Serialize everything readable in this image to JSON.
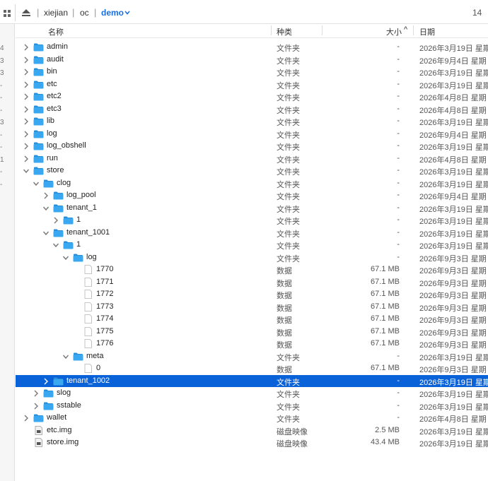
{
  "breadcrumbs": [
    "xiejian",
    "oc",
    "demo"
  ],
  "breadcrumb_separator": "|",
  "item_count": "14",
  "sidebar_fragments": [
    "4",
    "3",
    "3",
    "-",
    "-",
    "-",
    "3",
    "-",
    "-",
    "1",
    "-",
    "-"
  ],
  "columns": {
    "name": "名称",
    "kind": "种类",
    "size": "大小",
    "size_sort": "^",
    "date": "日期"
  },
  "rows": [
    {
      "name": "admin",
      "kind": "文件夹",
      "size": "-",
      "date": "2026年3月19日 星期",
      "level": 0,
      "type": "folder",
      "disc": "right"
    },
    {
      "name": "audit",
      "kind": "文件夹",
      "size": "-",
      "date": "2026年9月4日 星期",
      "level": 0,
      "type": "folder",
      "disc": "right"
    },
    {
      "name": "bin",
      "kind": "文件夹",
      "size": "-",
      "date": "2026年3月19日 星期",
      "level": 0,
      "type": "folder",
      "disc": "right"
    },
    {
      "name": "etc",
      "kind": "文件夹",
      "size": "-",
      "date": "2026年3月19日 星期",
      "level": 0,
      "type": "folder",
      "disc": "right"
    },
    {
      "name": "etc2",
      "kind": "文件夹",
      "size": "-",
      "date": "2026年4月8日 星期",
      "level": 0,
      "type": "folder",
      "disc": "right"
    },
    {
      "name": "etc3",
      "kind": "文件夹",
      "size": "-",
      "date": "2026年4月8日 星期",
      "level": 0,
      "type": "folder",
      "disc": "right"
    },
    {
      "name": "lib",
      "kind": "文件夹",
      "size": "-",
      "date": "2026年3月19日 星期",
      "level": 0,
      "type": "folder",
      "disc": "right"
    },
    {
      "name": "log",
      "kind": "文件夹",
      "size": "-",
      "date": "2026年9月4日 星期",
      "level": 0,
      "type": "folder",
      "disc": "right"
    },
    {
      "name": "log_obshell",
      "kind": "文件夹",
      "size": "-",
      "date": "2026年3月19日 星期",
      "level": 0,
      "type": "folder",
      "disc": "right"
    },
    {
      "name": "run",
      "kind": "文件夹",
      "size": "-",
      "date": "2026年4月8日 星期",
      "level": 0,
      "type": "folder",
      "disc": "right"
    },
    {
      "name": "store",
      "kind": "文件夹",
      "size": "-",
      "date": "2026年3月19日 星期",
      "level": 0,
      "type": "folder",
      "disc": "down"
    },
    {
      "name": "clog",
      "kind": "文件夹",
      "size": "-",
      "date": "2026年3月19日 星期",
      "level": 1,
      "type": "folder",
      "disc": "down"
    },
    {
      "name": "log_pool",
      "kind": "文件夹",
      "size": "-",
      "date": "2026年9月4日 星期",
      "level": 2,
      "type": "folder",
      "disc": "right"
    },
    {
      "name": "tenant_1",
      "kind": "文件夹",
      "size": "-",
      "date": "2026年3月19日 星期",
      "level": 2,
      "type": "folder",
      "disc": "down"
    },
    {
      "name": "1",
      "kind": "文件夹",
      "size": "-",
      "date": "2026年3月19日 星期",
      "level": 3,
      "type": "folder",
      "disc": "right"
    },
    {
      "name": "tenant_1001",
      "kind": "文件夹",
      "size": "-",
      "date": "2026年3月19日 星期",
      "level": 2,
      "type": "folder",
      "disc": "down"
    },
    {
      "name": "1",
      "kind": "文件夹",
      "size": "-",
      "date": "2026年3月19日 星期",
      "level": 3,
      "type": "folder",
      "disc": "down"
    },
    {
      "name": "log",
      "kind": "文件夹",
      "size": "-",
      "date": "2026年9月3日 星期",
      "level": 4,
      "type": "folder",
      "disc": "down"
    },
    {
      "name": "1770",
      "kind": "数据",
      "size": "67.1 MB",
      "date": "2026年9月3日 星期",
      "level": 5,
      "type": "file",
      "disc": "none"
    },
    {
      "name": "1771",
      "kind": "数据",
      "size": "67.1 MB",
      "date": "2026年9月3日 星期",
      "level": 5,
      "type": "file",
      "disc": "none"
    },
    {
      "name": "1772",
      "kind": "数据",
      "size": "67.1 MB",
      "date": "2026年9月3日 星期",
      "level": 5,
      "type": "file",
      "disc": "none"
    },
    {
      "name": "1773",
      "kind": "数据",
      "size": "67.1 MB",
      "date": "2026年9月3日 星期",
      "level": 5,
      "type": "file",
      "disc": "none"
    },
    {
      "name": "1774",
      "kind": "数据",
      "size": "67.1 MB",
      "date": "2026年9月3日 星期",
      "level": 5,
      "type": "file",
      "disc": "none"
    },
    {
      "name": "1775",
      "kind": "数据",
      "size": "67.1 MB",
      "date": "2026年9月3日 星期",
      "level": 5,
      "type": "file",
      "disc": "none"
    },
    {
      "name": "1776",
      "kind": "数据",
      "size": "67.1 MB",
      "date": "2026年9月3日 星期",
      "level": 5,
      "type": "file",
      "disc": "none"
    },
    {
      "name": "meta",
      "kind": "文件夹",
      "size": "-",
      "date": "2026年3月19日 星期",
      "level": 4,
      "type": "folder",
      "disc": "down"
    },
    {
      "name": "0",
      "kind": "数据",
      "size": "67.1 MB",
      "date": "2026年9月3日 星期",
      "level": 5,
      "type": "file",
      "disc": "none"
    },
    {
      "name": "tenant_1002",
      "kind": "文件夹",
      "size": "-",
      "date": "2026年3月19日 星期",
      "level": 2,
      "type": "folder",
      "disc": "right",
      "selected": true
    },
    {
      "name": "slog",
      "kind": "文件夹",
      "size": "-",
      "date": "2026年3月19日 星期",
      "level": 1,
      "type": "folder",
      "disc": "right"
    },
    {
      "name": "sstable",
      "kind": "文件夹",
      "size": "-",
      "date": "2026年3月19日 星期",
      "level": 1,
      "type": "folder",
      "disc": "right"
    },
    {
      "name": "wallet",
      "kind": "文件夹",
      "size": "-",
      "date": "2026年4月8日 星期",
      "level": 0,
      "type": "folder",
      "disc": "right"
    },
    {
      "name": "etc.img",
      "kind": "磁盘映像",
      "size": "2.5 MB",
      "date": "2026年3月19日 星期",
      "level": 0,
      "type": "image",
      "disc": "none"
    },
    {
      "name": "store.img",
      "kind": "磁盘映像",
      "size": "43.4 MB",
      "date": "2026年3月19日 星期",
      "level": 0,
      "type": "image",
      "disc": "none"
    }
  ],
  "colors": {
    "accent": "#0a62d9",
    "folder": "#3aa8f0",
    "folder_dark": "#2a8fd8",
    "breadcrumb_active": "#1a6fe0"
  }
}
